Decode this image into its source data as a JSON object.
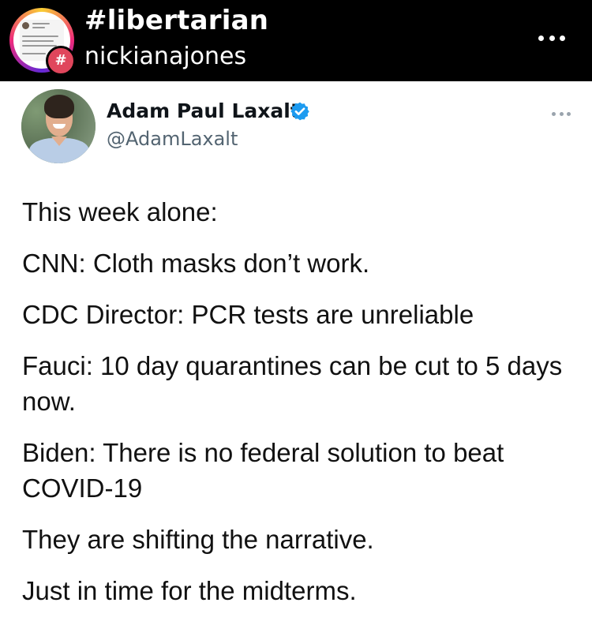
{
  "post_header": {
    "title": "#libertarian",
    "subtitle": "nickianajones",
    "badge_symbol": "#",
    "badge_color": "#e0465c",
    "more_icon": "more-horizontal-icon"
  },
  "tweet": {
    "author_name": "Adam Paul Laxalt",
    "author_handle": "@AdamLaxalt",
    "verified": true,
    "verified_color": "#1d9bf0",
    "more_icon": "more-horizontal-icon",
    "lines": [
      "This week alone:",
      "CNN: Cloth masks don’t work.",
      "CDC Director: PCR tests are unreliable",
      "Fauci: 10 day quarantines can be cut to 5 days now.",
      "Biden: There is no federal solution to beat COVID-19",
      "They are shifting the narrative.",
      "Just in time for the midterms."
    ]
  }
}
